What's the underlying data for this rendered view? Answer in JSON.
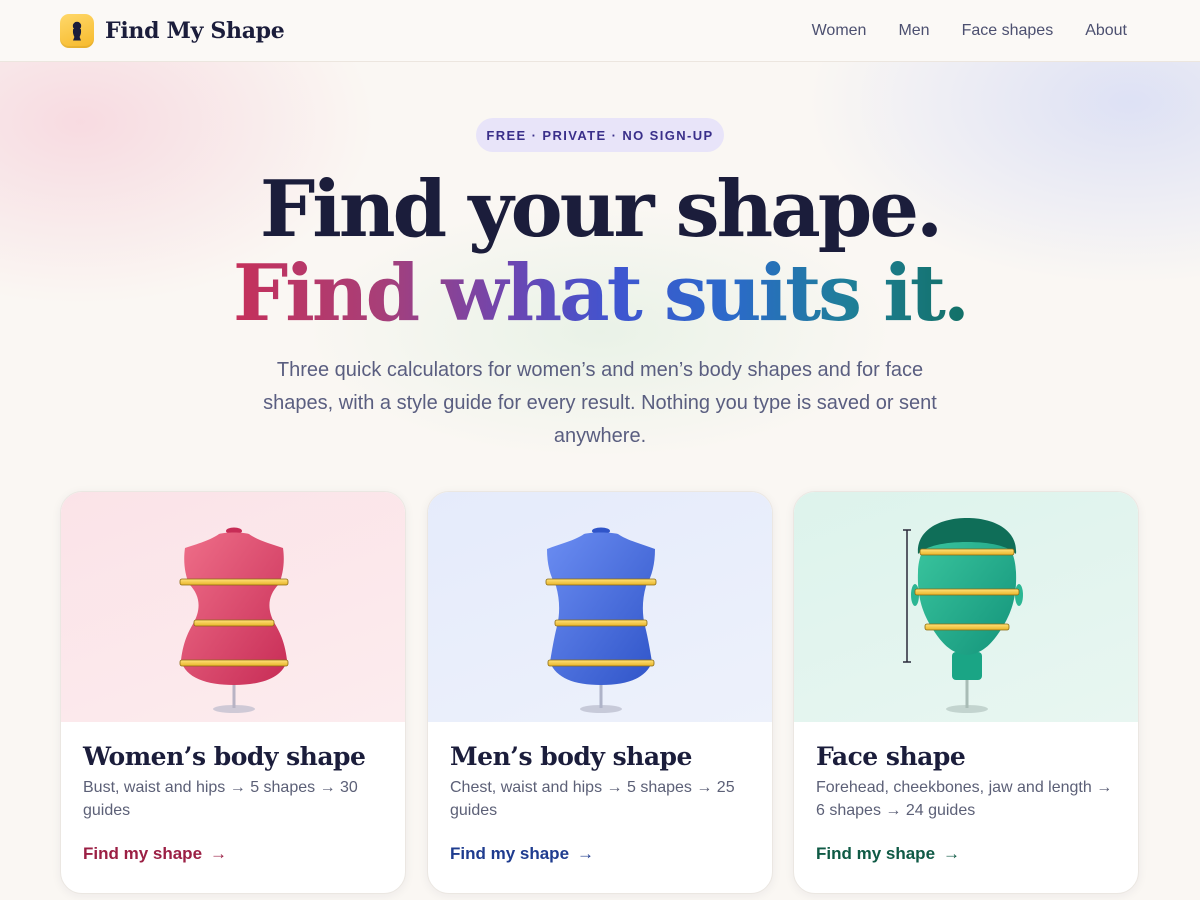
{
  "brand": {
    "name": "Find My Shape",
    "logo_icon": "keyhole-silhouette-icon"
  },
  "nav": {
    "items": [
      {
        "label": "Women"
      },
      {
        "label": "Men"
      },
      {
        "label": "Face shapes"
      },
      {
        "label": "About"
      }
    ]
  },
  "hero": {
    "badge": "FREE · PRIVATE · NO SIGN-UP",
    "title_line1": "Find your shape.",
    "title_line2": "Find what suits it.",
    "lede": "Three quick calculators for women’s and men’s body shapes and for face shapes, with a style guide for every result. Nothing you type is saved or sent anywhere."
  },
  "cards": [
    {
      "title": "Women’s body shape",
      "description": "Bust, waist and hips → 5 shapes → 30 guides",
      "cta": "Find my shape",
      "arrow": "→",
      "illustration": "hourglass-dress-form-icon",
      "accent": "#9b1f44"
    },
    {
      "title": "Men’s body shape",
      "description": "Chest, waist and hips → 5 shapes → 25 guides",
      "cta": "Find my shape",
      "arrow": "→",
      "illustration": "straight-dress-form-icon",
      "accent": "#1f3c8f"
    },
    {
      "title": "Face shape",
      "description": "Forehead, cheekbones, jaw and length → 6 shapes → 24 guides",
      "cta": "Find my shape",
      "arrow": "→",
      "illustration": "head-measure-icon",
      "accent": "#0f5a45"
    }
  ]
}
